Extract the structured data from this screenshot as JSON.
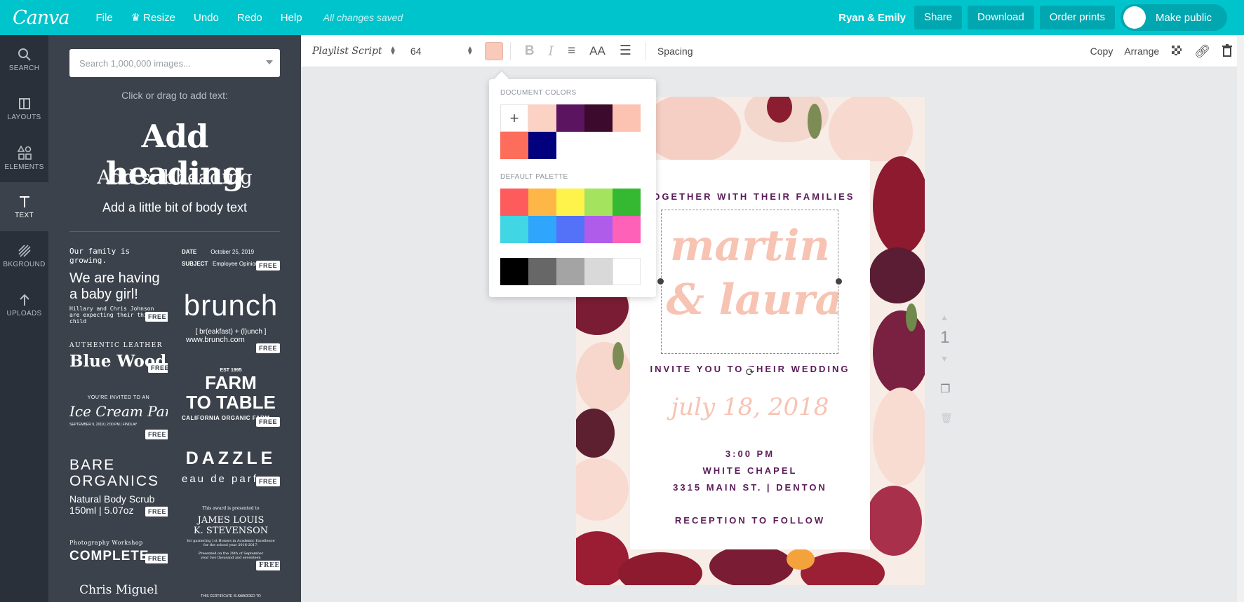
{
  "app": {
    "logo": "Canva",
    "menu": [
      {
        "label": "File"
      },
      {
        "label": "Resize"
      },
      {
        "label": "Undo"
      },
      {
        "label": "Redo"
      },
      {
        "label": "Help"
      }
    ],
    "save_status": "All changes saved",
    "user_name": "Ryan & Emily",
    "buttons": {
      "share": "Share",
      "download": "Download",
      "order_prints": "Order prints",
      "make_public": "Make public"
    },
    "accent": "#00c4cc"
  },
  "rail": [
    {
      "label": "SEARCH",
      "icon": "search-icon"
    },
    {
      "label": "LAYOUTS",
      "icon": "layouts-icon"
    },
    {
      "label": "ELEMENTS",
      "icon": "elements-icon"
    },
    {
      "label": "TEXT",
      "icon": "text-icon"
    },
    {
      "label": "BKGROUND",
      "icon": "background-icon"
    },
    {
      "label": "UPLOADS",
      "icon": "upload-icon"
    }
  ],
  "panel": {
    "search_placeholder": "Search 1,000,000 images...",
    "hint": "Click or drag to add text:",
    "add_heading": "Add heading",
    "add_subheading": "Add subheading",
    "add_body": "Add a little bit of body text",
    "free_label": "FREE",
    "templates": {
      "baby_1": "Our family is growing.",
      "baby_2": "We are having",
      "baby_3": "a baby girl!",
      "baby_4": "Hillary and Chris Johnson",
      "baby_5": "are expecting their third child",
      "memo_date_label": "DATE",
      "memo_date": "October 25, 2019",
      "memo_subject_label": "SUBJECT",
      "memo_subject": "Employee Opinion",
      "brunch": "brunch",
      "brunch_sub": "[ br(eakfast) + (l)unch ]",
      "brunch_url": "www.brunch.com",
      "leather_1": "AUTHENTIC LEATHER",
      "leather_2": "Blue Wood",
      "farm_1": "EST 1995",
      "farm_2": "FARM",
      "farm_3": "TO TABLE",
      "farm_4": "CALIFORNIA ORGANIC FARM",
      "ice_1": "YOU'RE INVITED TO AN",
      "ice_2": "Ice Cream Party",
      "ice_3": "SEPTEMBER 9, 2019 | 2:00 PM | FINDLAY",
      "dazzle_1": "DAZZLE",
      "dazzle_2": "eau de parfum",
      "bare_1": "BARE",
      "bare_2": "ORGANICS",
      "bare_3": "Natural Body Scrub",
      "bare_4": "150ml | 5.07oz",
      "award_1": "This award is presented to",
      "award_2": "JAMES LOUIS",
      "award_3": "K. STEVENSON",
      "award_4": "for garnering 1st Honors in Academic Excellence",
      "award_5": "for the school year 2016-2017.",
      "award_6": "Presented on the 28th of September",
      "award_7": "year two thousand and seventeen",
      "photo_1": "Photography Workshop",
      "photo_2": "COMPLETE",
      "chris": "Chris Miguel",
      "cert": "THIS CERTIFICATE IS AWARDED TO"
    }
  },
  "toolbar": {
    "font": "Playlist Script",
    "size": "64",
    "text_color": "#f9c9b9",
    "spacing": "Spacing",
    "copy": "Copy",
    "arrange": "Arrange"
  },
  "picker": {
    "document_label": "DOCUMENT COLORS",
    "document_colors": [
      "#fcd2c4",
      "#5b1560",
      "#3b0a2c",
      "#fdc3b2",
      "#fd6d5b",
      "#01007d"
    ],
    "default_label": "DEFAULT PALETTE",
    "default_colors": [
      "#fe5c5c",
      "#feb646",
      "#fef34b",
      "#a4e35e",
      "#36b932",
      "#41d6e3",
      "#2fa6fb",
      "#5472f8",
      "#b05cea",
      "#fd61b8"
    ],
    "gray_colors": [
      "#000000",
      "#676767",
      "#a4a4a4",
      "#d9d9d9",
      "#ffffff"
    ]
  },
  "design": {
    "line1": "TOGETHER WITH THEIR FAMILIES",
    "name1": "martin",
    "name2": "& laura",
    "line2": "INVITE YOU TO THEIR WEDDING",
    "date": "july 18, 2018",
    "time": "3:00 PM",
    "venue": "WHITE CHAPEL",
    "address": "3315 MAIN ST. | DENTON",
    "reception": "RECEPTION TO FOLLOW"
  },
  "page_number": "1"
}
